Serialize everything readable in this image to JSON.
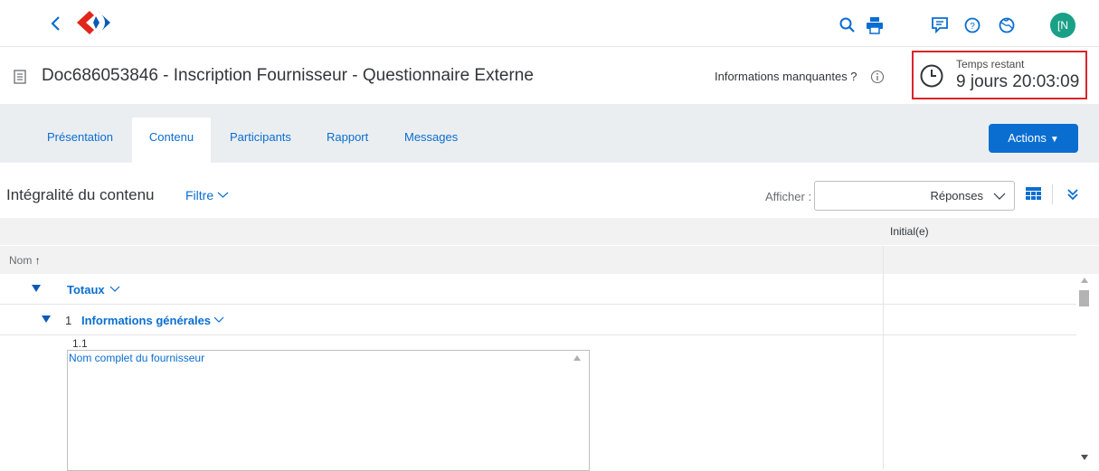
{
  "shell": {
    "icons": [
      "back-icon",
      "carrefour-logo",
      "search-icon",
      "print-icon",
      "feedback-icon",
      "help-icon",
      "globe-icon"
    ],
    "avatar_initials": "N",
    "avatar_color": "#1aa086"
  },
  "header": {
    "title": "Doc686053846 - Inscription Fournisseur - Questionnaire Externe",
    "missing_info": "Informations manquantes ?",
    "timer_label": "Temps restant",
    "timer_value": "9 jours 20:03:09",
    "highlight_color": "#d9262c"
  },
  "tabs": [
    {
      "label": "Présentation",
      "active": false
    },
    {
      "label": "Contenu",
      "active": true
    },
    {
      "label": "Participants",
      "active": false
    },
    {
      "label": "Rapport",
      "active": false
    },
    {
      "label": "Messages",
      "active": false
    }
  ],
  "actions_label": "Actions",
  "content": {
    "title": "Intégralité du contenu",
    "filter_label": "Filtre",
    "show_label": "Afficher :",
    "show_value": "Réponses"
  },
  "table": {
    "column_group": "Initial(e)",
    "name_header": "Nom",
    "rows": [
      {
        "label": "Totaux"
      },
      {
        "number": "1",
        "label": "Informations générales"
      }
    ],
    "item_number": "1.1",
    "item_text": "Nom complet du fournisseur"
  },
  "colors": {
    "accent": "#0a6ed1",
    "tabbar": "#ebeef1"
  }
}
